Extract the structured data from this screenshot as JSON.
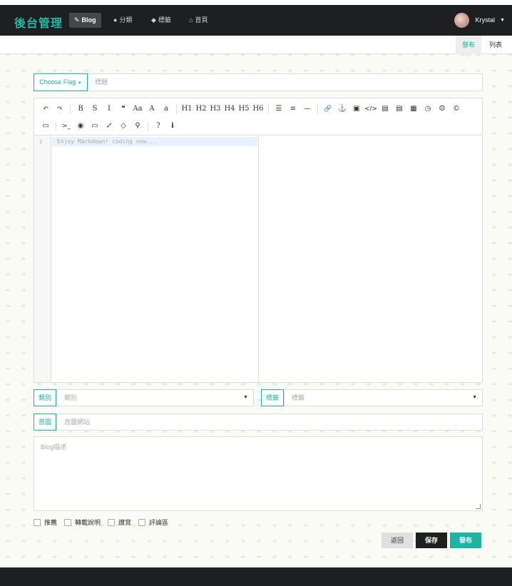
{
  "navbar": {
    "brand": "後台管理",
    "items": [
      {
        "icon": "✎",
        "label": "Blog"
      },
      {
        "icon": "●",
        "label": "分類"
      },
      {
        "icon": "◆",
        "label": "標籤"
      },
      {
        "icon": "⌂",
        "label": "首頁"
      }
    ],
    "user": "Krystal"
  },
  "subtabs": [
    "發布",
    "列表"
  ],
  "form": {
    "flag_button": "Choose Flag",
    "title_placeholder": "標題",
    "editor_line_number": "1",
    "editor_placeholder": "Enjoy Markdown! coding now...",
    "category_label": "類別",
    "category_placeholder": "類別",
    "tag_label": "標籤",
    "tag_placeholder": "標籤",
    "cover_label": "首圖",
    "cover_placeholder": "首圖網站",
    "desc_placeholder": "Blog描述",
    "checkboxes": [
      "推薦",
      "轉載說明",
      "讚賞",
      "評論區"
    ],
    "buttons": {
      "back": "返回",
      "save": "保存",
      "publish": "發布"
    }
  },
  "toolbar": {
    "row1": [
      "↶",
      "↷",
      "|",
      "B",
      "S",
      "I",
      "❝",
      "Aa",
      "A",
      "a",
      "|",
      "H1",
      "H2",
      "H3",
      "H4",
      "H5",
      "H6",
      "|",
      "☰",
      "≡",
      "—",
      "|",
      "🔗",
      "⚓",
      "▣",
      "</>",
      "▤",
      "▤",
      "▦",
      "◷",
      "☺",
      "©"
    ],
    "row2": [
      "▭",
      "|",
      ">_",
      "◉",
      "▭",
      "⤢",
      "◇",
      "⚲",
      "|",
      "?",
      "ℹ"
    ]
  },
  "colors": {
    "accent": "#1cb5a3",
    "nav_bg": "#1d1f21"
  }
}
